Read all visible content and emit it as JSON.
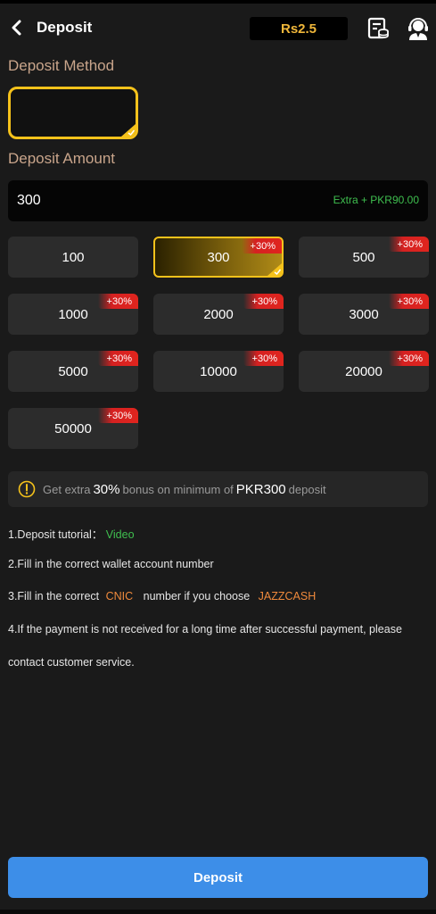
{
  "header": {
    "title": "Deposit",
    "balance": "Rs2.5",
    "icons": {
      "back": "chevron-left-icon",
      "records": "records-icon",
      "support": "customer-support-icon"
    }
  },
  "deposit_method": {
    "label": "Deposit Method"
  },
  "deposit_amount": {
    "label": "Deposit Amount",
    "value": "300",
    "extra": "Extra + PKR90.00"
  },
  "amounts": [
    {
      "value": "100",
      "bonus": ""
    },
    {
      "value": "300",
      "bonus": "+30%",
      "selected": true
    },
    {
      "value": "500",
      "bonus": "+30%"
    },
    {
      "value": "1000",
      "bonus": "+30%"
    },
    {
      "value": "2000",
      "bonus": "+30%"
    },
    {
      "value": "3000",
      "bonus": "+30%"
    },
    {
      "value": "5000",
      "bonus": "+30%"
    },
    {
      "value": "10000",
      "bonus": "+30%"
    },
    {
      "value": "20000",
      "bonus": "+30%"
    },
    {
      "value": "50000",
      "bonus": "+30%"
    }
  ],
  "notice": {
    "pre": "Get extra",
    "percent": "30%",
    "mid": "bonus on minimum of",
    "amount": "PKR300",
    "post": "deposit"
  },
  "steps": {
    "s1_text": "1.Deposit tutorial：",
    "s1_link": "Video",
    "s2_text": "2.Fill in the correct wallet account number",
    "s3_pre": "3.Fill in the correct",
    "s3_cnic": "CNIC",
    "s3_mid": "number if you choose",
    "s3_jazz": "JAZZCASH",
    "s4_line1": "4.If the payment is not received for a long time after successful payment, please",
    "s4_line2": "contact customer service."
  },
  "footer": {
    "deposit_label": "Deposit"
  },
  "colors": {
    "accent_gold": "#f5c21b",
    "balance_gold": "#f0b73a",
    "button_blue": "#3d8ee8",
    "bonus_red": "#e0251e",
    "link_green": "#3fbf4f",
    "highlight_orange": "#f08a3c"
  }
}
